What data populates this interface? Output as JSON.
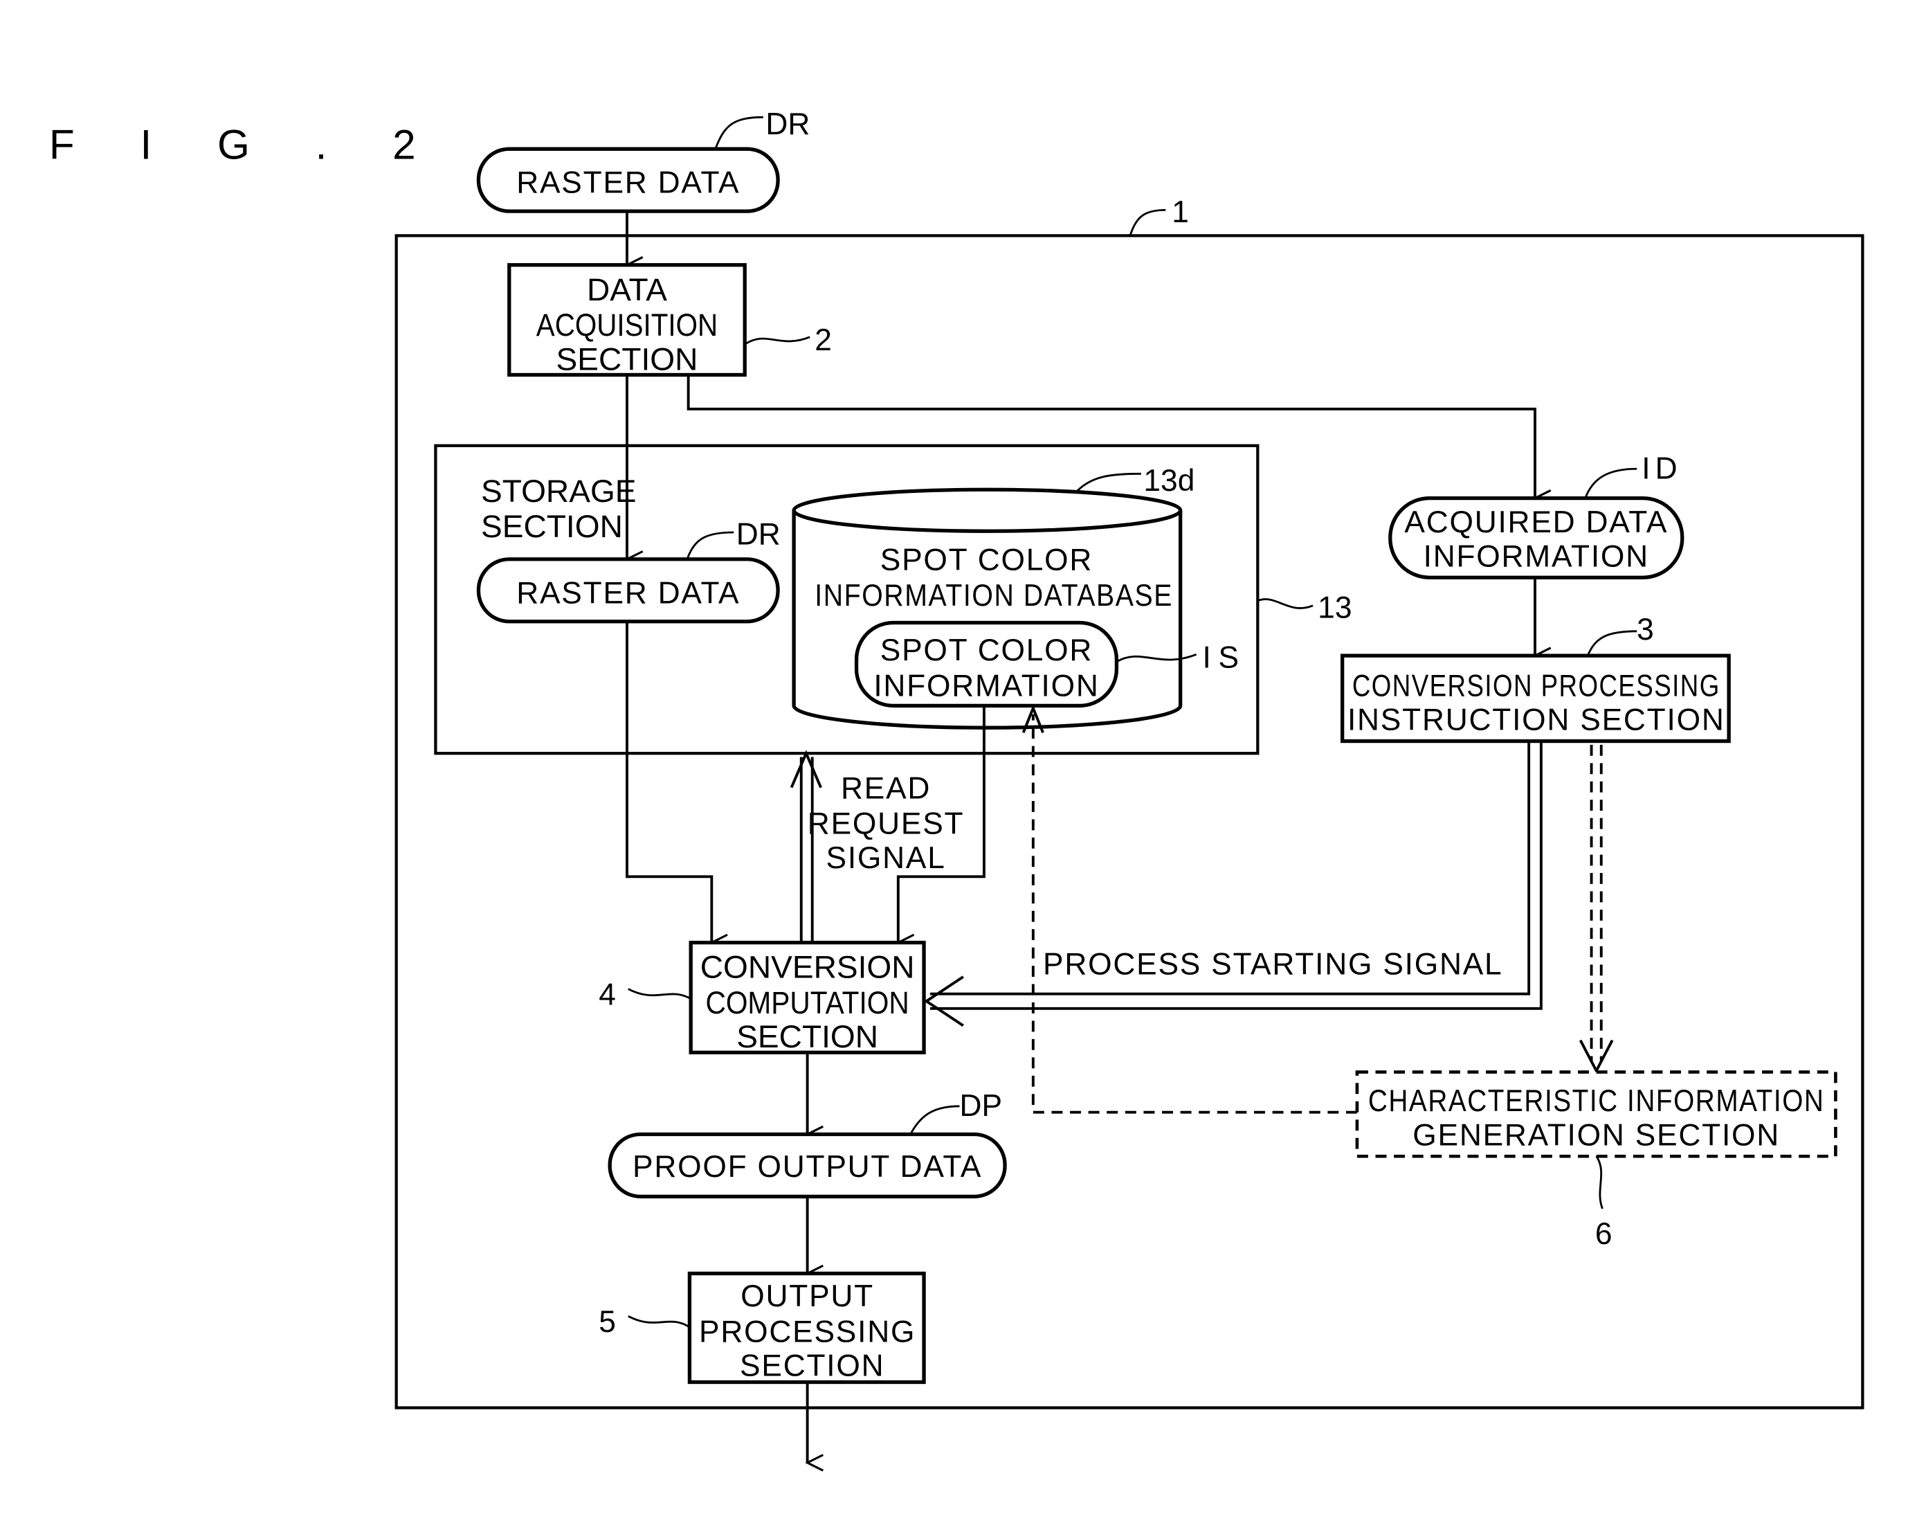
{
  "figure": {
    "label": "F I G . 2"
  },
  "nodes": {
    "raster_data_input": {
      "lines": [
        "RASTER DATA"
      ],
      "ref": "DR"
    },
    "image_processing_apparatus": {
      "ref": "1"
    },
    "data_acquisition_section": {
      "lines": [
        "DATA",
        "ACQUISITION",
        "SECTION"
      ],
      "ref": "2"
    },
    "storage_section": {
      "lines": [
        "STORAGE",
        "SECTION"
      ],
      "ref": "13"
    },
    "raster_data_stored": {
      "lines": [
        "RASTER DATA"
      ],
      "ref": "DR"
    },
    "spot_color_database": {
      "lines": [
        "SPOT COLOR",
        "INFORMATION DATABASE"
      ],
      "ref": "13d"
    },
    "spot_color_information": {
      "lines": [
        "SPOT COLOR",
        "INFORMATION"
      ],
      "ref": "IS"
    },
    "acquired_data_information": {
      "lines": [
        "ACQUIRED DATA",
        "INFORMATION"
      ],
      "ref": "ID"
    },
    "conversion_processing_instruction_section": {
      "lines": [
        "CONVERSION PROCESSING",
        "INSTRUCTION SECTION"
      ],
      "ref": "3"
    },
    "conversion_computation_section": {
      "lines": [
        "CONVERSION",
        "COMPUTATION",
        "SECTION"
      ],
      "ref": "4"
    },
    "proof_output_data": {
      "lines": [
        "PROOF OUTPUT DATA"
      ],
      "ref": "DP"
    },
    "output_processing_section": {
      "lines": [
        "OUTPUT",
        "PROCESSING",
        "SECTION"
      ],
      "ref": "5"
    },
    "characteristic_information_generation_section": {
      "lines": [
        "CHARACTERISTIC INFORMATION",
        "GENERATION SECTION"
      ],
      "ref": "6"
    }
  },
  "signals": {
    "read_request": {
      "lines": [
        "READ",
        "REQUEST",
        "SIGNAL"
      ]
    },
    "process_starting": {
      "lines": [
        "PROCESS STARTING SIGNAL"
      ]
    }
  }
}
